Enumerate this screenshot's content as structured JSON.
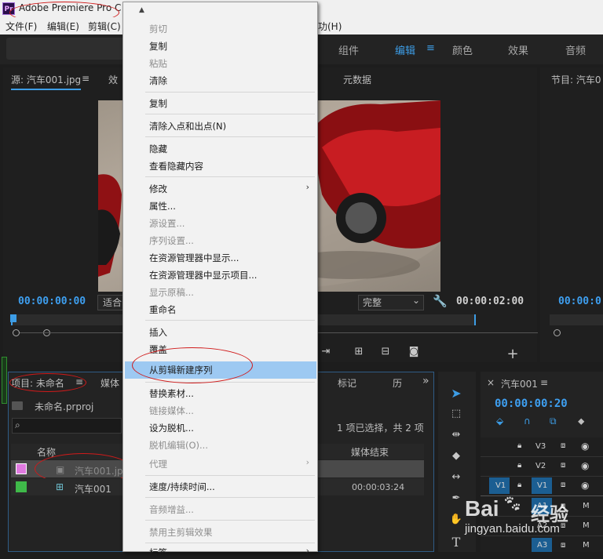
{
  "app": {
    "title": "Adobe Premiere Pro C",
    "logo": "Pr"
  },
  "menubar": {
    "file": "文件(F)",
    "edit": "编辑(E)",
    "clip": "剪辑(C)",
    "help": "功(H)"
  },
  "workspaces": {
    "assembly": "组件",
    "edit": "编辑",
    "color": "颜色",
    "effects": "效果",
    "audio": "音频"
  },
  "source": {
    "tab_label": "源: 汽车001.jpg",
    "effects_tab": "效",
    "metadata_tab": "元数据",
    "timecode_in": "00:00:00:00",
    "fit": "适合",
    "quality": "完整",
    "timecode_out": "00:00:02:00"
  },
  "program": {
    "tab_label": "节目: 汽车0",
    "timecode": "00:00:0"
  },
  "project": {
    "tab_label": "项目: 未命名",
    "media_tab": "媒体",
    "markers_tab": "标记",
    "history_tab": "历",
    "file_name": "未命名.prproj",
    "selection_status": "1 项已选择，共 2 项",
    "col_name": "名称",
    "col_media_end": "媒体结束",
    "items": [
      {
        "name": "汽车001.jpg",
        "media_end": "",
        "color": "#e07ae0"
      },
      {
        "name": "汽车001",
        "media_end": "00:00:03:24",
        "color": "#3fb949"
      }
    ]
  },
  "timeline": {
    "tab_label": "汽车001",
    "timecode": "00:00:00:20",
    "tracks": [
      {
        "name": "V3"
      },
      {
        "name": "V2"
      },
      {
        "name": "V1"
      },
      {
        "name": "A1"
      },
      {
        "name": "A2"
      },
      {
        "name": "A3"
      }
    ],
    "src_v1": "V1",
    "src_a1": "A1"
  },
  "context_menu": {
    "items": [
      {
        "label": "剪切",
        "disabled": true
      },
      {
        "label": "复制",
        "disabled": false
      },
      {
        "label": "粘贴",
        "disabled": true
      },
      {
        "label": "清除",
        "disabled": false
      },
      {
        "label": "复制",
        "disabled": false
      },
      {
        "label": "清除入点和出点(N)",
        "disabled": false
      },
      {
        "label": "隐藏",
        "disabled": false
      },
      {
        "label": "查看隐藏内容",
        "disabled": false
      },
      {
        "label": "修改",
        "disabled": false,
        "submenu": true
      },
      {
        "label": "属性...",
        "disabled": false
      },
      {
        "label": "源设置...",
        "disabled": true
      },
      {
        "label": "序列设置...",
        "disabled": true
      },
      {
        "label": "在资源管理器中显示...",
        "disabled": false
      },
      {
        "label": "在资源管理器中显示项目...",
        "disabled": false
      },
      {
        "label": "显示原稿...",
        "disabled": true
      },
      {
        "label": "重命名",
        "disabled": false
      },
      {
        "label": "插入",
        "disabled": false
      },
      {
        "label": "覆盖",
        "disabled": false
      },
      {
        "label": "从剪辑新建序列",
        "disabled": false,
        "highlighted": true
      },
      {
        "label": "替换素材...",
        "disabled": false
      },
      {
        "label": "链接媒体...",
        "disabled": true
      },
      {
        "label": "设为脱机...",
        "disabled": false
      },
      {
        "label": "脱机编辑(O)...",
        "disabled": true
      },
      {
        "label": "代理",
        "disabled": true,
        "submenu": true
      },
      {
        "label": "速度/持续时间...",
        "disabled": false
      },
      {
        "label": "音频增益...",
        "disabled": true
      },
      {
        "label": "禁用主剪辑效果",
        "disabled": true
      },
      {
        "label": "标签",
        "disabled": false,
        "submenu": true
      }
    ]
  },
  "watermark": {
    "brand": "Bai",
    "brand_suffix": "经验",
    "url": "jingyan.baidu.com"
  },
  "colors": {
    "accent": "#3d9de6",
    "highlight": "#9dc9f2",
    "annotation": "#d01a1a"
  },
  "icons": [
    "scroll-up-arrow-icon",
    "selection-tool-icon",
    "track-select-icon",
    "ripple-edit-icon",
    "razor-icon",
    "slip-icon",
    "pen-icon",
    "hand-icon",
    "type-icon",
    "wrench-icon",
    "add-icon",
    "camera-icon",
    "eye-icon",
    "lock-icon",
    "folder-icon",
    "search-icon"
  ]
}
